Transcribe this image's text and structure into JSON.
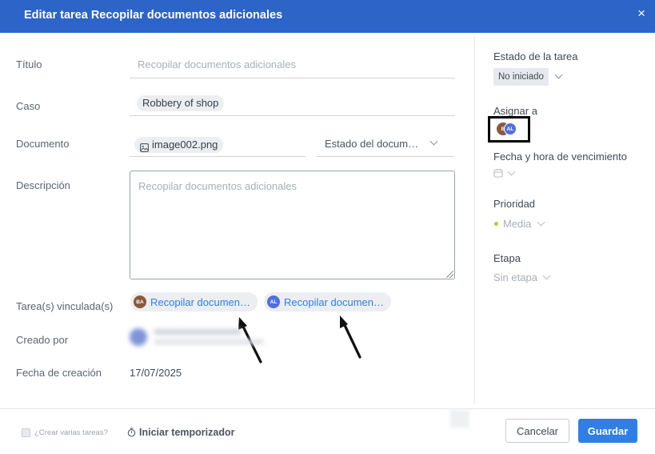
{
  "header": {
    "title": "Editar tarea Recopilar documentos adicionales",
    "close": "×"
  },
  "form": {
    "title_label": "Título",
    "title_placeholder": "Recopilar documentos adicionales",
    "case_label": "Caso",
    "case_value": "Robbery of shop",
    "document_label": "Documento",
    "document_file": "image002.png",
    "document_state": "Estado del docum…",
    "description_label": "Descripción",
    "description_placeholder": "Recopilar documentos adicionales",
    "linked_label": "Tarea(s) vinculada(s)",
    "linked_tasks": [
      {
        "initials": "BA",
        "text": "Recopilar documen…",
        "avatar_color": "#8a5a3c"
      },
      {
        "initials": "AL",
        "text": "Recopilar documen…",
        "avatar_color": "#4f6fe0"
      }
    ],
    "created_by_label": "Creado por",
    "created_date_label": "Fecha de creación",
    "created_date": "17/07/2025"
  },
  "sidebar": {
    "status_label": "Estado de la tarea",
    "status_value": "No iniciado",
    "assign_label": "Asignar a",
    "assignees": [
      {
        "initials": "B",
        "color": "#8a5a3c"
      },
      {
        "initials": "AL",
        "color": "#4f6fe0"
      }
    ],
    "due_label": "Fecha y hora de vencimiento",
    "priority_label": "Prioridad",
    "priority_value": "Media",
    "priority_color": "#a8d32c",
    "stage_label": "Etapa",
    "stage_value": "Sin etapa"
  },
  "footer": {
    "multi_label": "¿Crear varias tareas?",
    "timer_label": "Iniciar temporizador",
    "cancel": "Cancelar",
    "save": "Guardar"
  },
  "colors": {
    "header": "#2d64c8",
    "accent": "#2f7fe6"
  },
  "icons": [
    "close-icon",
    "image-icon",
    "chevron-down-icon",
    "calendar-icon",
    "stopwatch-icon",
    "arrow-annotation-icon"
  ]
}
